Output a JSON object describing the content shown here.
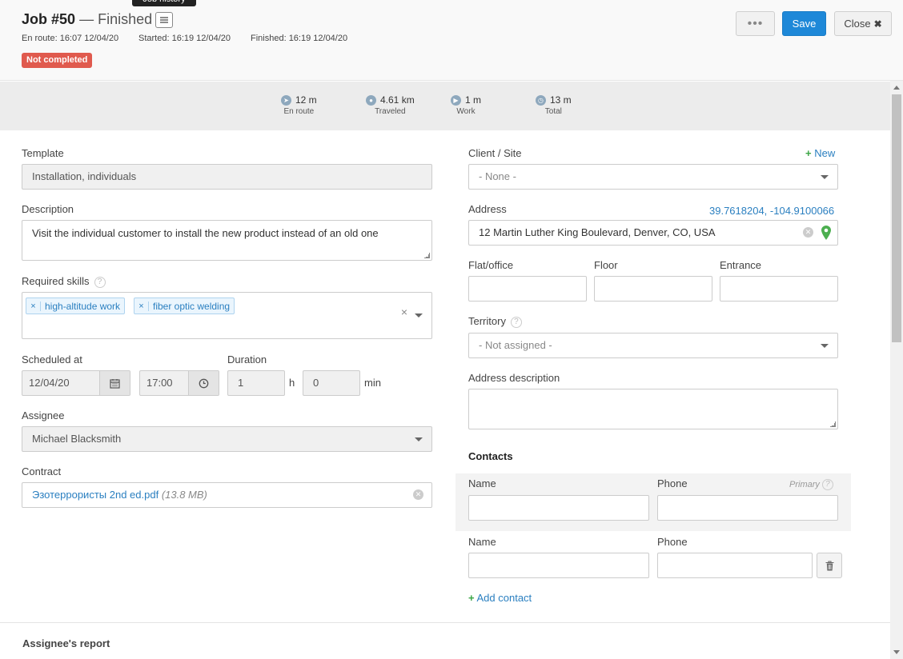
{
  "header": {
    "job_number": "Job #50",
    "status": "Finished",
    "tooltip": "Job history",
    "en_route": "En route: 16:07 12/04/20",
    "started": "Started: 16:19 12/04/20",
    "finished": "Finished: 16:19 12/04/20",
    "badge": "Not completed",
    "more_label": "•••",
    "save_label": "Save",
    "close_label": "Close"
  },
  "stats": [
    {
      "icon": "route-icon",
      "value": "12 m",
      "label": "En route"
    },
    {
      "icon": "location-icon",
      "value": "4.61 km",
      "label": "Traveled"
    },
    {
      "icon": "play-icon",
      "value": "1 m",
      "label": "Work"
    },
    {
      "icon": "clock-icon",
      "value": "13 m",
      "label": "Total"
    }
  ],
  "left": {
    "template_label": "Template",
    "template_value": "Installation, individuals",
    "description_label": "Description",
    "description_value": "Visit the individual customer to install the new product instead of an old one",
    "skills_label": "Required skills",
    "skills": [
      "high-altitude work",
      "fiber optic welding"
    ],
    "scheduled_label": "Scheduled at",
    "date_value": "12/04/20",
    "time_value": "17:00",
    "duration_label": "Duration",
    "hours_value": "1",
    "hours_unit": "h",
    "minutes_value": "0",
    "minutes_unit": "min",
    "assignee_label": "Assignee",
    "assignee_value": "Michael Blacksmith",
    "contract_label": "Contract",
    "contract_file": "Эзотеррористы 2nd ed.pdf",
    "contract_size": "(13.8 MB)"
  },
  "right": {
    "client_label": "Client / Site",
    "new_label": "New",
    "client_value": "- None -",
    "address_label": "Address",
    "coordinates": "39.7618204, -104.9100066",
    "address_value": "12 Martin Luther King Boulevard, Denver, CO, USA",
    "flat_label": "Flat/office",
    "floor_label": "Floor",
    "entrance_label": "Entrance",
    "territory_label": "Territory",
    "territory_value": "- Not assigned -",
    "address_desc_label": "Address description",
    "contacts_title": "Contacts",
    "name_label": "Name",
    "phone_label": "Phone",
    "primary_label": "Primary",
    "add_contact_label": "Add contact"
  },
  "footer": {
    "report_title": "Assignee's report"
  },
  "colors": {
    "accent": "#1e88d8",
    "badge": "#e05a4e",
    "link": "#2a7fc0",
    "green": "#3aa544"
  }
}
